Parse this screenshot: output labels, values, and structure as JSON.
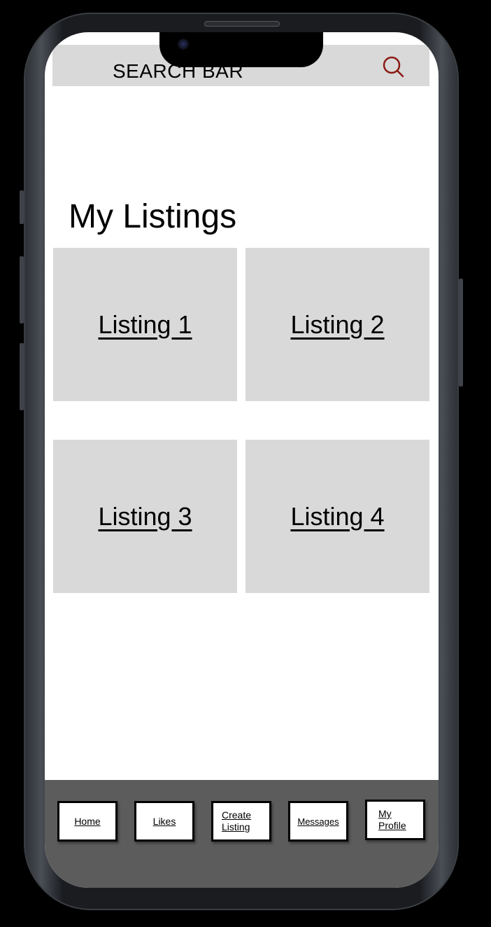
{
  "search": {
    "label": "SEARCH BAR"
  },
  "main": {
    "title": "My Listings",
    "listings": [
      {
        "label": "Listing 1"
      },
      {
        "label": "Listing 2"
      },
      {
        "label": "Listing 3"
      },
      {
        "label": "Listing 4"
      }
    ]
  },
  "nav": {
    "items": [
      {
        "label": "Home"
      },
      {
        "label": "Likes"
      },
      {
        "label": "Create Listing"
      },
      {
        "label": "Messages"
      },
      {
        "label": "My Profile"
      }
    ]
  },
  "colors": {
    "search_icon": "#8b1a14",
    "tile": "#d9d9d9",
    "nav_background": "#5c5c5c"
  }
}
